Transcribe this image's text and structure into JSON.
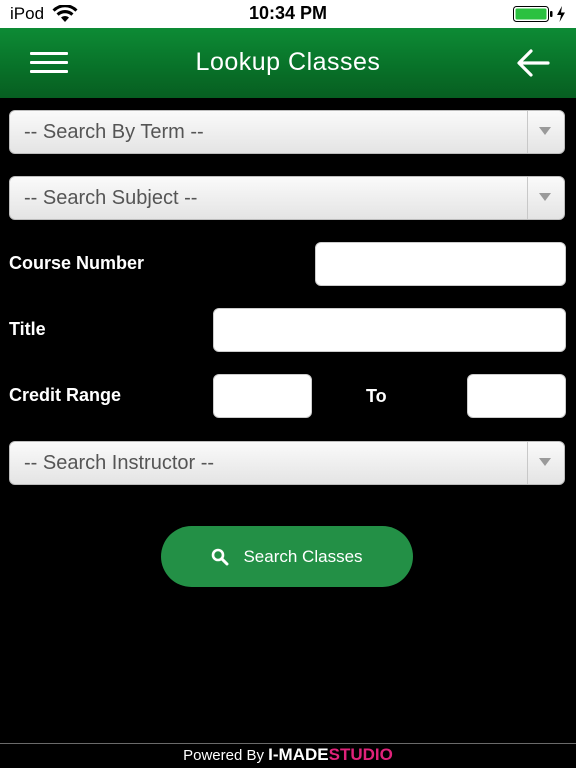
{
  "status_bar": {
    "carrier": "iPod",
    "time": "10:34 PM",
    "wifi_icon": "wifi-icon",
    "battery_icon": "battery-icon",
    "charging_icon": "bolt-icon"
  },
  "header": {
    "title": "Lookup Classes",
    "menu_icon": "hamburger-icon",
    "back_icon": "arrow-left-icon",
    "color": "#0a7f2f"
  },
  "form": {
    "term_select": {
      "selected": "-- Search By Term --"
    },
    "subject_select": {
      "selected": "-- Search Subject --"
    },
    "course_number": {
      "label": "Course Number",
      "value": ""
    },
    "title_field": {
      "label": "Title",
      "value": ""
    },
    "credit_range": {
      "label": "Credit Range",
      "to_label": "To",
      "min_value": "",
      "max_value": ""
    },
    "instructor_select": {
      "selected": "-- Search Instructor --"
    },
    "search_button": {
      "label": "Search Classes",
      "icon": "search-icon",
      "color": "#239046"
    }
  },
  "footer": {
    "prefix": "Powered By",
    "brand_part1": "I-MADE",
    "brand_part2": "STUDIO",
    "brand_color": "#e0227a"
  }
}
